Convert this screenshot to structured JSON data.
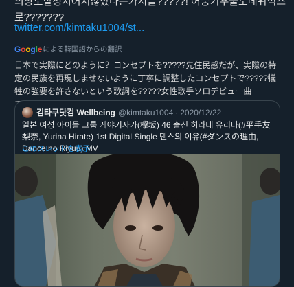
{
  "tweet": {
    "text_line1": "의상도할정지어지않았다는가지를?????! 어중기우물도데워익스",
    "text_line2": "로???????",
    "link": "twitter.com/kimtaku1004/st..."
  },
  "translation": {
    "google": "Google",
    "by_label": "による韓国語からの翻訳",
    "text": "日本で実際にどのように？コンセプトを?????先住民感だが、実際の特定の民族を再現しませないように丁寧に調整したコンセプトで?????犠牲の強要を許さないという歌詞を?????女性歌手ソロデビュー曲で???????"
  },
  "quote": {
    "name": "김타쿠닷컴 Wellbeing",
    "handle": "@kimtaku1004",
    "separator": "·",
    "date": "2020/12/22",
    "text": "일본 여성 아이돌 그룹 케야키자카(欅坂) 46 출신 히라테 유리나(#平手友梨奈, Yurina Hirate) 1st Digital Single 댄스의 이유(#ダンスの理由, Dance no Riyuu) MV",
    "thread_link": "このスレッドを表示"
  }
}
